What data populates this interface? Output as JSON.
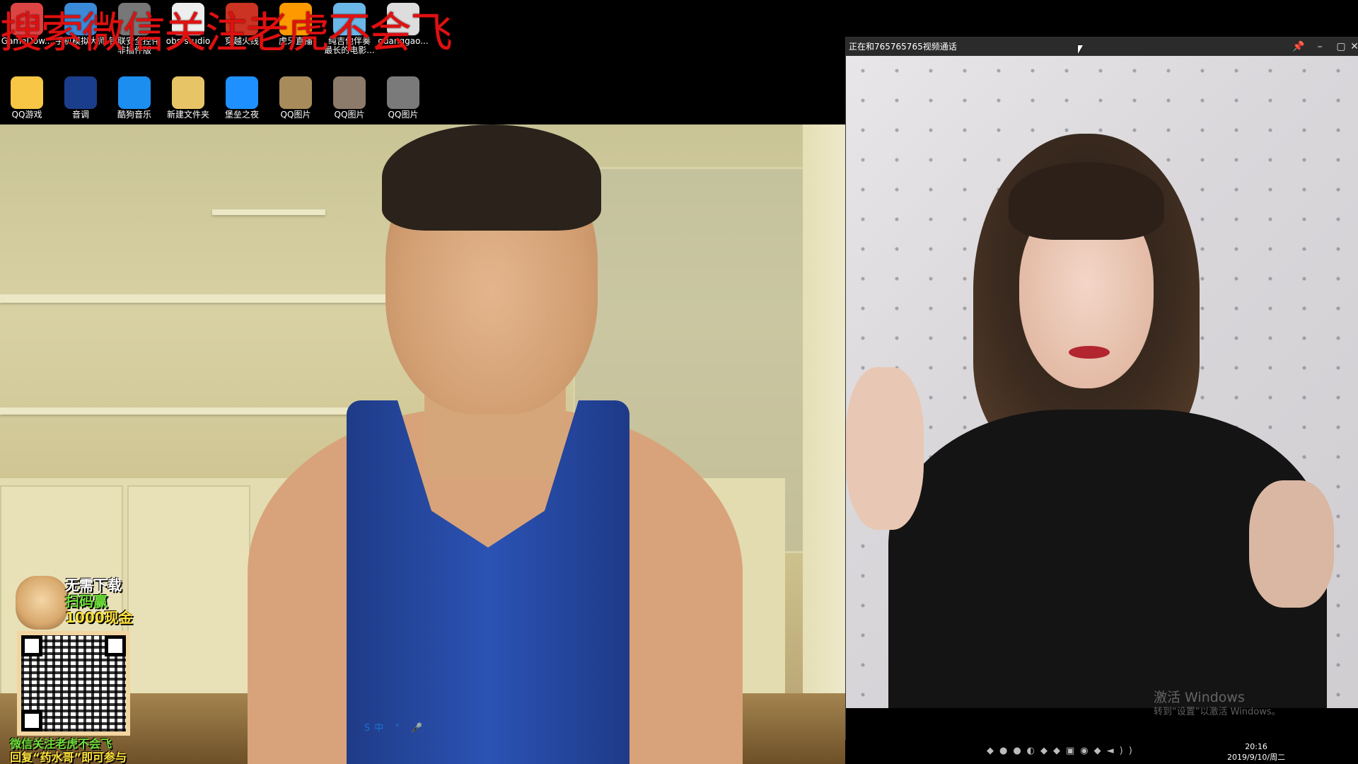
{
  "overlay_text": "搜索微信关注老虎不会飞",
  "desktop": {
    "row1": [
      {
        "label": "GameDow...",
        "icon": "game-download-icon",
        "color": "#d44"
      },
      {
        "label": "手机模拟大师",
        "icon": "phone-emulator-icon",
        "color": "#3a8ad8"
      },
      {
        "label": "银联安全控件\n非插件版",
        "icon": "unionpay-security-icon",
        "color": "#777"
      },
      {
        "label": "obs-studio",
        "icon": "obs-file-icon",
        "color": "#eee"
      },
      {
        "label": "穿越火线",
        "icon": "crossfire-icon",
        "color": "#c32"
      },
      {
        "label": "虎牙直播",
        "icon": "huya-icon",
        "color": "#f90"
      },
      {
        "label": "纯吉他伴奏\n最长的电影...",
        "icon": "mp3-file-icon",
        "color": "#6ab7e8"
      },
      {
        "label": "guanggao...",
        "icon": "image-file-icon",
        "color": "#ddd"
      }
    ],
    "row2": [
      {
        "label": "QQ游戏",
        "icon": "qq-game-icon",
        "color": "#f6c644"
      },
      {
        "label": "音调",
        "icon": "kuwo-kk-icon",
        "color": "#1b3e8c"
      },
      {
        "label": "酷狗音乐",
        "icon": "kugou-icon",
        "color": "#1b8ef0"
      },
      {
        "label": "新建文件夹",
        "icon": "folder-icon",
        "color": "#e7c567"
      },
      {
        "label": "堡垒之夜",
        "icon": "fortnite-icon",
        "color": "#1e90ff"
      },
      {
        "label": "QQ图片",
        "icon": "qq-image-icon",
        "color": "#a88b5a"
      },
      {
        "label": "QQ图片",
        "icon": "qq-image-icon",
        "color": "#8c7a6a"
      },
      {
        "label": "QQ图片",
        "icon": "qq-image-icon",
        "color": "#7a7a7a"
      }
    ]
  },
  "promo": {
    "line1": "无需下载",
    "line2": "扫码赢",
    "line3": "1000现金",
    "bottom1": "微信关注老虎不会飞",
    "bottom2": "回复“药水哥”即可参与"
  },
  "call_window": {
    "title": "正在和765765765视频通话",
    "buttons": {
      "pin": "📌",
      "minimize": "–",
      "maximize": "▢",
      "close": "✕"
    }
  },
  "watermark": {
    "line1": "激活 Windows",
    "line2": "转到“设置”以激活 Windows。"
  },
  "taskbar": {
    "time": "20:16",
    "date": "2019/9/10/周二",
    "ime": "S中 ° 🎤"
  }
}
